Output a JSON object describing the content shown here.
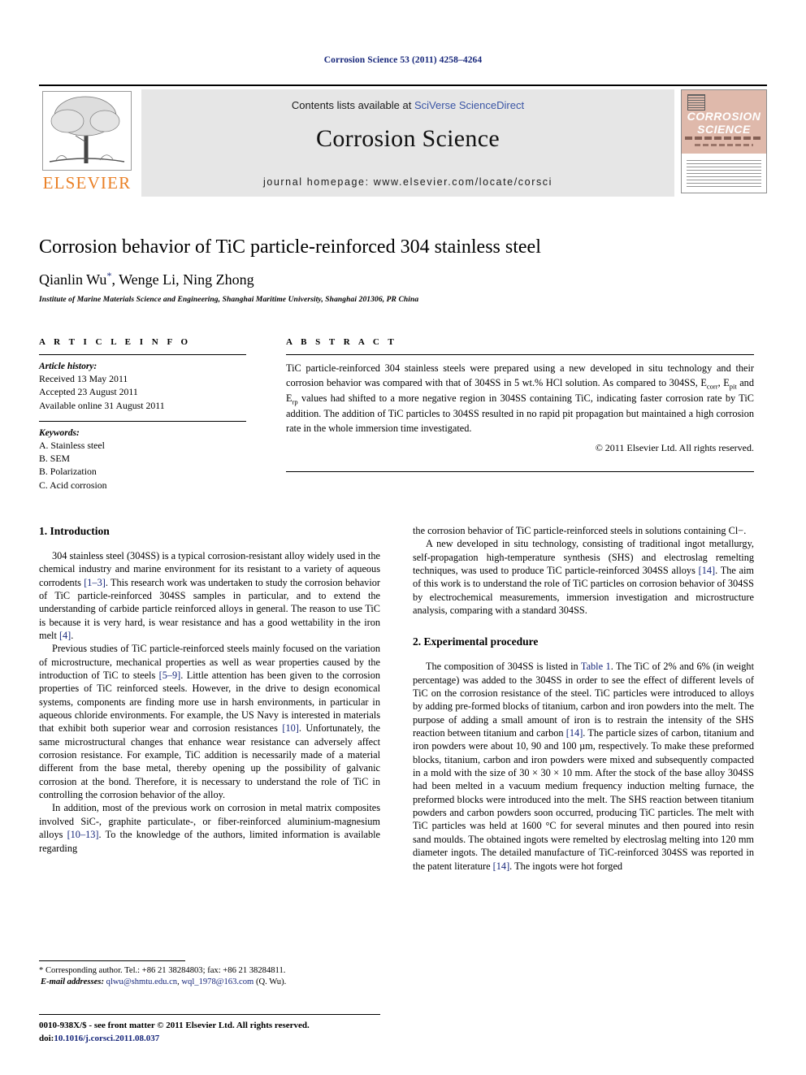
{
  "running_head": "Corrosion Science 53 (2011) 4258–4264",
  "masthead": {
    "publisher_wordmark": "ELSEVIER",
    "contents_prefix": "Contents lists available at ",
    "contents_link": "SciVerse ScienceDirect",
    "journal_title": "Corrosion Science",
    "homepage": "journal homepage: www.elsevier.com/locate/corsci",
    "cover_line1": "CORROSION",
    "cover_line2": "SCIENCE",
    "link_color": "#3a55a5",
    "banner_bg": "#e6e6e6",
    "cover_bg": "#dfb9ab",
    "elsevier_orange": "#ea8026"
  },
  "article": {
    "title": "Corrosion behavior of TiC particle-reinforced 304 stainless steel",
    "authors": "Qianlin Wu",
    "authors_rest": ", Wenge Li, Ning Zhong",
    "corresponding_marker": "*",
    "affiliation": "Institute of Marine Materials Science and Engineering, Shanghai Maritime University, Shanghai 201306, PR China"
  },
  "info": {
    "heading": "A R T I C L E   I N F O",
    "history_label": "Article history:",
    "history": [
      "Received 13 May 2011",
      "Accepted 23 August 2011",
      "Available online 31 August 2011"
    ],
    "keywords_label": "Keywords:",
    "keywords": [
      "A. Stainless steel",
      "B. SEM",
      "B. Polarization",
      "C. Acid corrosion"
    ]
  },
  "abstract": {
    "heading": "A B S T R A C T",
    "p1_a": "TiC particle-reinforced 304 stainless steels were prepared using a new developed in situ technology and their corrosion behavior was compared with that of 304SS in 5 wt.% HCl solution. As compared to 304SS, E",
    "sub1": "corr",
    "p1_b": ", E",
    "sub2": "pit",
    "p1_c": " and E",
    "sub3": "rp",
    "p1_d": " values had shifted to a more negative region in 304SS containing TiC, indicating faster corrosion rate by TiC addition. The addition of TiC particles to 304SS resulted in no rapid pit propagation but maintained a high corrosion rate in the whole immersion time investigated.",
    "copyright": "© 2011 Elsevier Ltd. All rights reserved."
  },
  "body": {
    "intro_heading": "1. Introduction",
    "intro_p1_a": "304 stainless steel (304SS) is a typical corrosion-resistant alloy widely used in the chemical industry and marine environment for its resistant to a variety of aqueous corrodents ",
    "intro_p1_ref1": "[1–3]",
    "intro_p1_b": ". This research work was undertaken to study the corrosion behavior of TiC particle-reinforced 304SS samples in particular, and to extend the understanding of carbide particle reinforced alloys in general. The reason to use TiC is because it is very hard, is wear resistance and has a good wettability in the iron melt ",
    "intro_p1_ref2": "[4]",
    "intro_p1_c": ".",
    "intro_p2_a": "Previous studies of TiC particle-reinforced steels mainly focused on the variation of microstructure, mechanical properties as well as wear properties caused by the introduction of TiC to steels ",
    "intro_p2_ref1": "[5–9]",
    "intro_p2_b": ". Little attention has been given to the corrosion properties of TiC reinforced steels. However, in the drive to design economical systems, components are finding more use in harsh environments, in particular in aqueous chloride environments. For example, the US Navy is interested in materials that exhibit both superior wear and corrosion resistances ",
    "intro_p2_ref2": "[10]",
    "intro_p2_c": ". Unfortunately, the same microstructural changes that enhance wear resistance can adversely affect corrosion resistance. For example, TiC addition is necessarily made of a material different from the base metal, thereby opening up the possibility of galvanic corrosion at the bond. Therefore, it is necessary to understand the role of TiC in controlling the corrosion behavior of the alloy.",
    "intro_p3_a": "In addition, most of the previous work on corrosion in metal matrix composites involved SiC-, graphite particulate-, or fiber-reinforced aluminium-magnesium alloys ",
    "intro_p3_ref1": "[10–13]",
    "intro_p3_b": ". To the knowledge of the authors, limited information is available regarding the corrosion behavior of TiC particle-reinforced steels in solutions containing Cl",
    "intro_p3_sup": "−",
    "intro_p3_c": ".",
    "intro_p4_a": "A new developed in situ technology, consisting of traditional ingot metallurgy, self-propagation high-temperature synthesis (SHS) and electroslag remelting techniques, was used to produce TiC particle-reinforced 304SS alloys ",
    "intro_p4_ref1": "[14]",
    "intro_p4_b": ". The aim of this work is to understand the role of TiC particles on corrosion behavior of 304SS by electrochemical measurements, immersion investigation and microstructure analysis, comparing with a standard 304SS.",
    "exp_heading": "2. Experimental procedure",
    "exp_p1_a": "The composition of 304SS is listed in ",
    "exp_p1_table": "Table 1",
    "exp_p1_b": ". The TiC of 2% and 6% (in weight percentage) was added to the 304SS in order to see the effect of different levels of TiC on the corrosion resistance of the steel. TiC particles were introduced to alloys by adding pre-formed blocks of titanium, carbon and iron powders into the melt. The purpose of adding a small amount of iron is to restrain the intensity of the SHS reaction between titanium and carbon ",
    "exp_p1_ref1": "[14]",
    "exp_p1_c": ". The particle sizes of carbon, titanium and iron powders were about 10, 90 and 100 µm, respectively. To make these preformed blocks, titanium, carbon and iron powders were mixed and subsequently compacted in a mold with the size of 30 × 30 × 10 mm. After the stock of the base alloy 304SS had been melted in a vacuum medium frequency induction melting furnace, the preformed blocks were introduced into the melt. The SHS reaction between titanium powders and carbon powders soon occurred, producing TiC particles. The melt with TiC particles was held at 1600 °C for several minutes and then poured into resin sand moulds. The obtained ingots were remelted by electroslag melting into 120 mm diameter ingots. The detailed manufacture of TiC-reinforced 304SS was reported in the patent literature ",
    "exp_p1_ref2": "[14]",
    "exp_p1_d": ". The ingots were hot forged"
  },
  "footnotes": {
    "corresponding_marker": "*",
    "corresponding": " Corresponding author. Tel.: +86 21 38284803; fax: +86 21 38284811.",
    "email_label": "E-mail addresses:",
    "email1": "qlwu@shmtu.edu.cn",
    "email_sep": ", ",
    "email2": "wql_1978@163.com",
    "email_suffix": " (Q. Wu).",
    "issn_line": "0010-938X/$ - see front matter © 2011 Elsevier Ltd. All rights reserved.",
    "doi_label": "doi:",
    "doi_value": "10.1016/j.corsci.2011.08.037"
  }
}
